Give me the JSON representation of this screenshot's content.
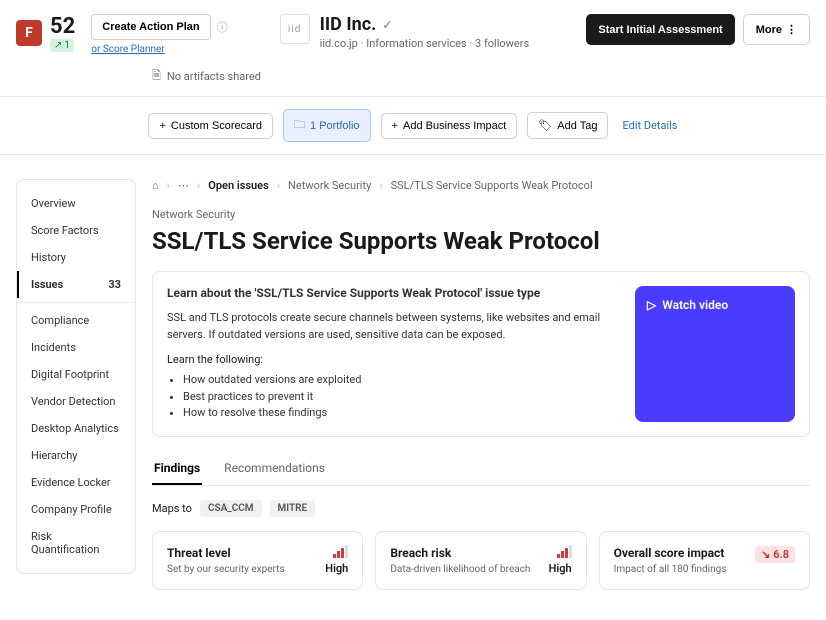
{
  "header": {
    "grade": "F",
    "score": "52",
    "delta": "1",
    "action_btn": "Create Action Plan",
    "planner_link": "or Score Planner",
    "logo_text": "iid",
    "company_name": "IID Inc.",
    "domain": "iid.co.jp",
    "industry": "Information services",
    "followers": "3 followers",
    "artifacts": "No artifacts shared",
    "start_btn": "Start Initial Assessment",
    "more_btn": "More"
  },
  "toolbar": {
    "custom": "Custom Scorecard",
    "portfolio": "1 Portfolio",
    "impact": "Add Business Impact",
    "tag": "Add Tag",
    "edit": "Edit Details"
  },
  "sidebar": {
    "items": [
      "Overview",
      "Score Factors",
      "History",
      "Issues",
      "Compliance",
      "Incidents",
      "Digital Footprint",
      "Vendor Detection",
      "Desktop Analytics",
      "Hierarchy",
      "Evidence Locker",
      "Company Profile",
      "Risk Quantification"
    ],
    "issues_count": "33"
  },
  "breadcrumb": {
    "open": "Open issues",
    "cat": "Network Security",
    "page": "SSL/TLS Service Supports Weak Protocol"
  },
  "page": {
    "subtitle": "Network Security",
    "title": "SSL/TLS Service Supports Weak Protocol"
  },
  "learn": {
    "title": "Learn about the 'SSL/TLS Service Supports Weak Protocol' issue type",
    "body": "SSL and TLS protocols create secure channels between systems, like websites and email servers. If outdated versions are used, sensitive data can be exposed.",
    "sub": "Learn the following:",
    "items": [
      "How outdated versions are exploited",
      "Best practices to prevent it",
      "How to resolve these findings"
    ],
    "video": "Watch video"
  },
  "tabs": {
    "findings": "Findings",
    "recs": "Recommendations"
  },
  "maps": {
    "label": "Maps to",
    "t1": "CSA_CCM",
    "t2": "MITRE"
  },
  "cards": {
    "threat": {
      "title": "Threat level",
      "sub": "Set by our security experts",
      "val": "High"
    },
    "breach": {
      "title": "Breach risk",
      "sub": "Data-driven likelihood of breach",
      "val": "High"
    },
    "impact": {
      "title": "Overall score impact",
      "sub": "Impact of all 180 findings",
      "val": "6.8"
    }
  }
}
